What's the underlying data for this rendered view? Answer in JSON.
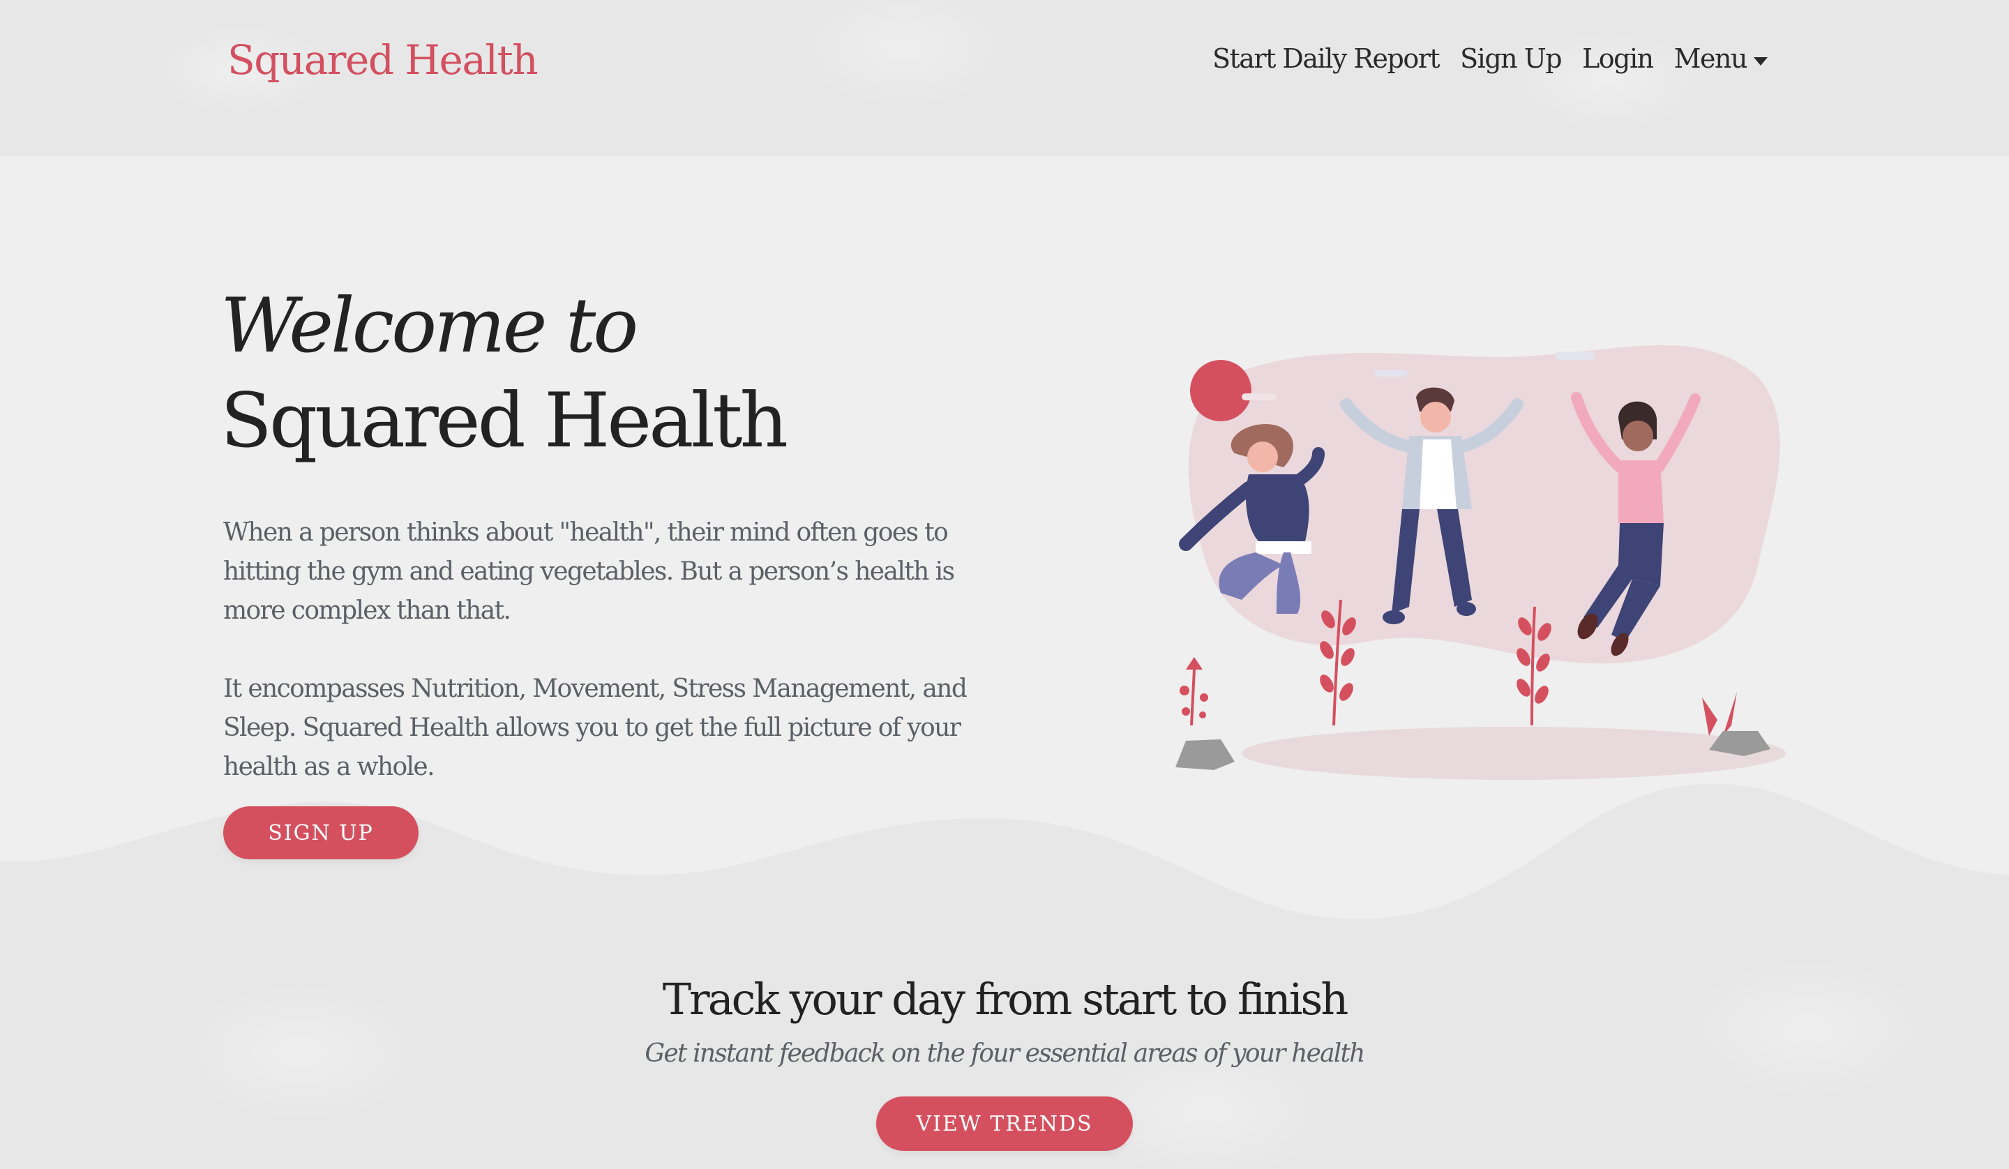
{
  "brand": "Squared Health",
  "nav": {
    "items": [
      "Start Daily Report",
      "Sign Up",
      "Login"
    ],
    "menu_label": "Menu"
  },
  "hero": {
    "title_line1": "Welcome to",
    "title_line2": "Squared Health",
    "paragraph1": "When a person thinks about \"health\", their mind often goes to hitting the gym and eating vegetables. But a person’s health is more complex than that.",
    "paragraph2": "It encompasses Nutrition, Movement, Stress Management, and Sleep. Squared Health allows you to get the full picture of your health as a whole.",
    "signup_button": "Sign up"
  },
  "track": {
    "title": "Track your day from start to finish",
    "subtitle": "Get instant feedback on the four essential areas of your health",
    "button": "View Trends"
  },
  "colors": {
    "accent": "#d5505f",
    "text_dark": "#222222",
    "text_muted": "#5c5f66",
    "background": "#efefef"
  }
}
